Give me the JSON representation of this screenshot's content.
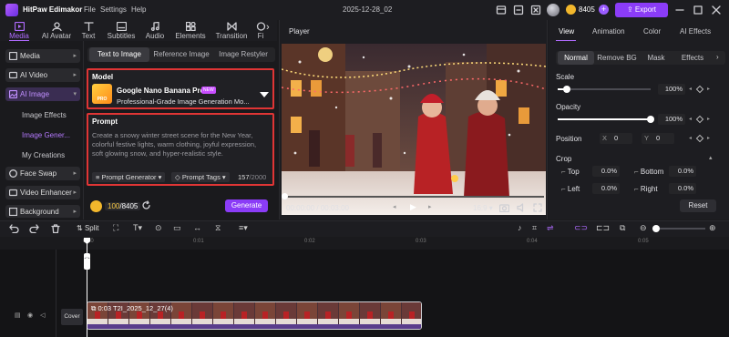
{
  "app": {
    "name": "HitPaw Edimakor",
    "project_name": "2025-12-28_02"
  },
  "menu": [
    "File",
    "Settings",
    "Help"
  ],
  "account": {
    "coins": "8405",
    "export_label": "Export"
  },
  "toolbar": [
    {
      "label": "Media",
      "icon": "media-icon"
    },
    {
      "label": "AI Avatar",
      "icon": "ai-avatar-icon"
    },
    {
      "label": "Text",
      "icon": "text-icon"
    },
    {
      "label": "Subtitles",
      "icon": "subtitles-icon"
    },
    {
      "label": "Audio",
      "icon": "audio-icon"
    },
    {
      "label": "Elements",
      "icon": "elements-icon"
    },
    {
      "label": "Transition",
      "icon": "transition-icon"
    },
    {
      "label": "Fi",
      "icon": "filter-icon"
    }
  ],
  "sidenav": {
    "items": [
      "Media",
      "AI Video",
      "AI Image",
      "Face Swap",
      "Video Enhancer",
      "Background"
    ],
    "sub_items": [
      "Image Effects",
      "Image Gener...",
      "My Creations"
    ]
  },
  "image_tabs": [
    "Text to Image",
    "Reference Image",
    "Image Restyler"
  ],
  "model": {
    "section_label": "Model",
    "name": "Google Nano Banana Pro",
    "badge": "NEW",
    "thumb_label": "PRO",
    "description": "Professional-Grade Image Generation Mo..."
  },
  "prompt": {
    "section_label": "Prompt",
    "text": "Create a snowy winter street scene for the New Year, colorful festive lights, warm clothing, joyful expression, soft glowing snow, and hyper-realistic style.",
    "generator_label": "Prompt Generator",
    "tags_label": "Prompt Tags",
    "count": "157",
    "max": "/2000"
  },
  "generate": {
    "credits_used": "100",
    "credits_total": "/8405",
    "button_label": "Generate"
  },
  "player": {
    "label": "Player",
    "current_time": "00:00:00",
    "total_time": "/ 00:03:00",
    "ratio": "16:9"
  },
  "props": {
    "tabs": [
      "View",
      "Animation",
      "Color",
      "AI Effects"
    ],
    "segments": [
      "Normal",
      "Remove BG",
      "Mask",
      "Effects"
    ],
    "scale_label": "Scale",
    "scale_value": "100%",
    "scale_fraction": 0.1,
    "opacity_label": "Opacity",
    "opacity_value": "100%",
    "opacity_fraction": 1.0,
    "position_label": "Position",
    "pos_x_label": "X",
    "pos_x": "0",
    "pos_y_label": "Y",
    "pos_y": "0",
    "crop_label": "Crop",
    "crop": [
      {
        "label": "Top",
        "value": "0.0%"
      },
      {
        "label": "Bottom",
        "value": "0.0%"
      },
      {
        "label": "Left",
        "value": "0.0%"
      },
      {
        "label": "Right",
        "value": "0.0%"
      }
    ],
    "reset_label": "Reset"
  },
  "timeline": {
    "split_label": "Split",
    "ticks": [
      "0:00",
      "0:01",
      "0:02",
      "0:03",
      "0:04",
      "0:05"
    ],
    "cover_label": "Cover",
    "clip_label": "0:03  T2I_2025_12_27(4)"
  },
  "colors": {
    "accent": "#8b3cf7",
    "accent_text": "#b06bff",
    "highlight_border": "#e03535",
    "coin": "#f2b72c"
  }
}
